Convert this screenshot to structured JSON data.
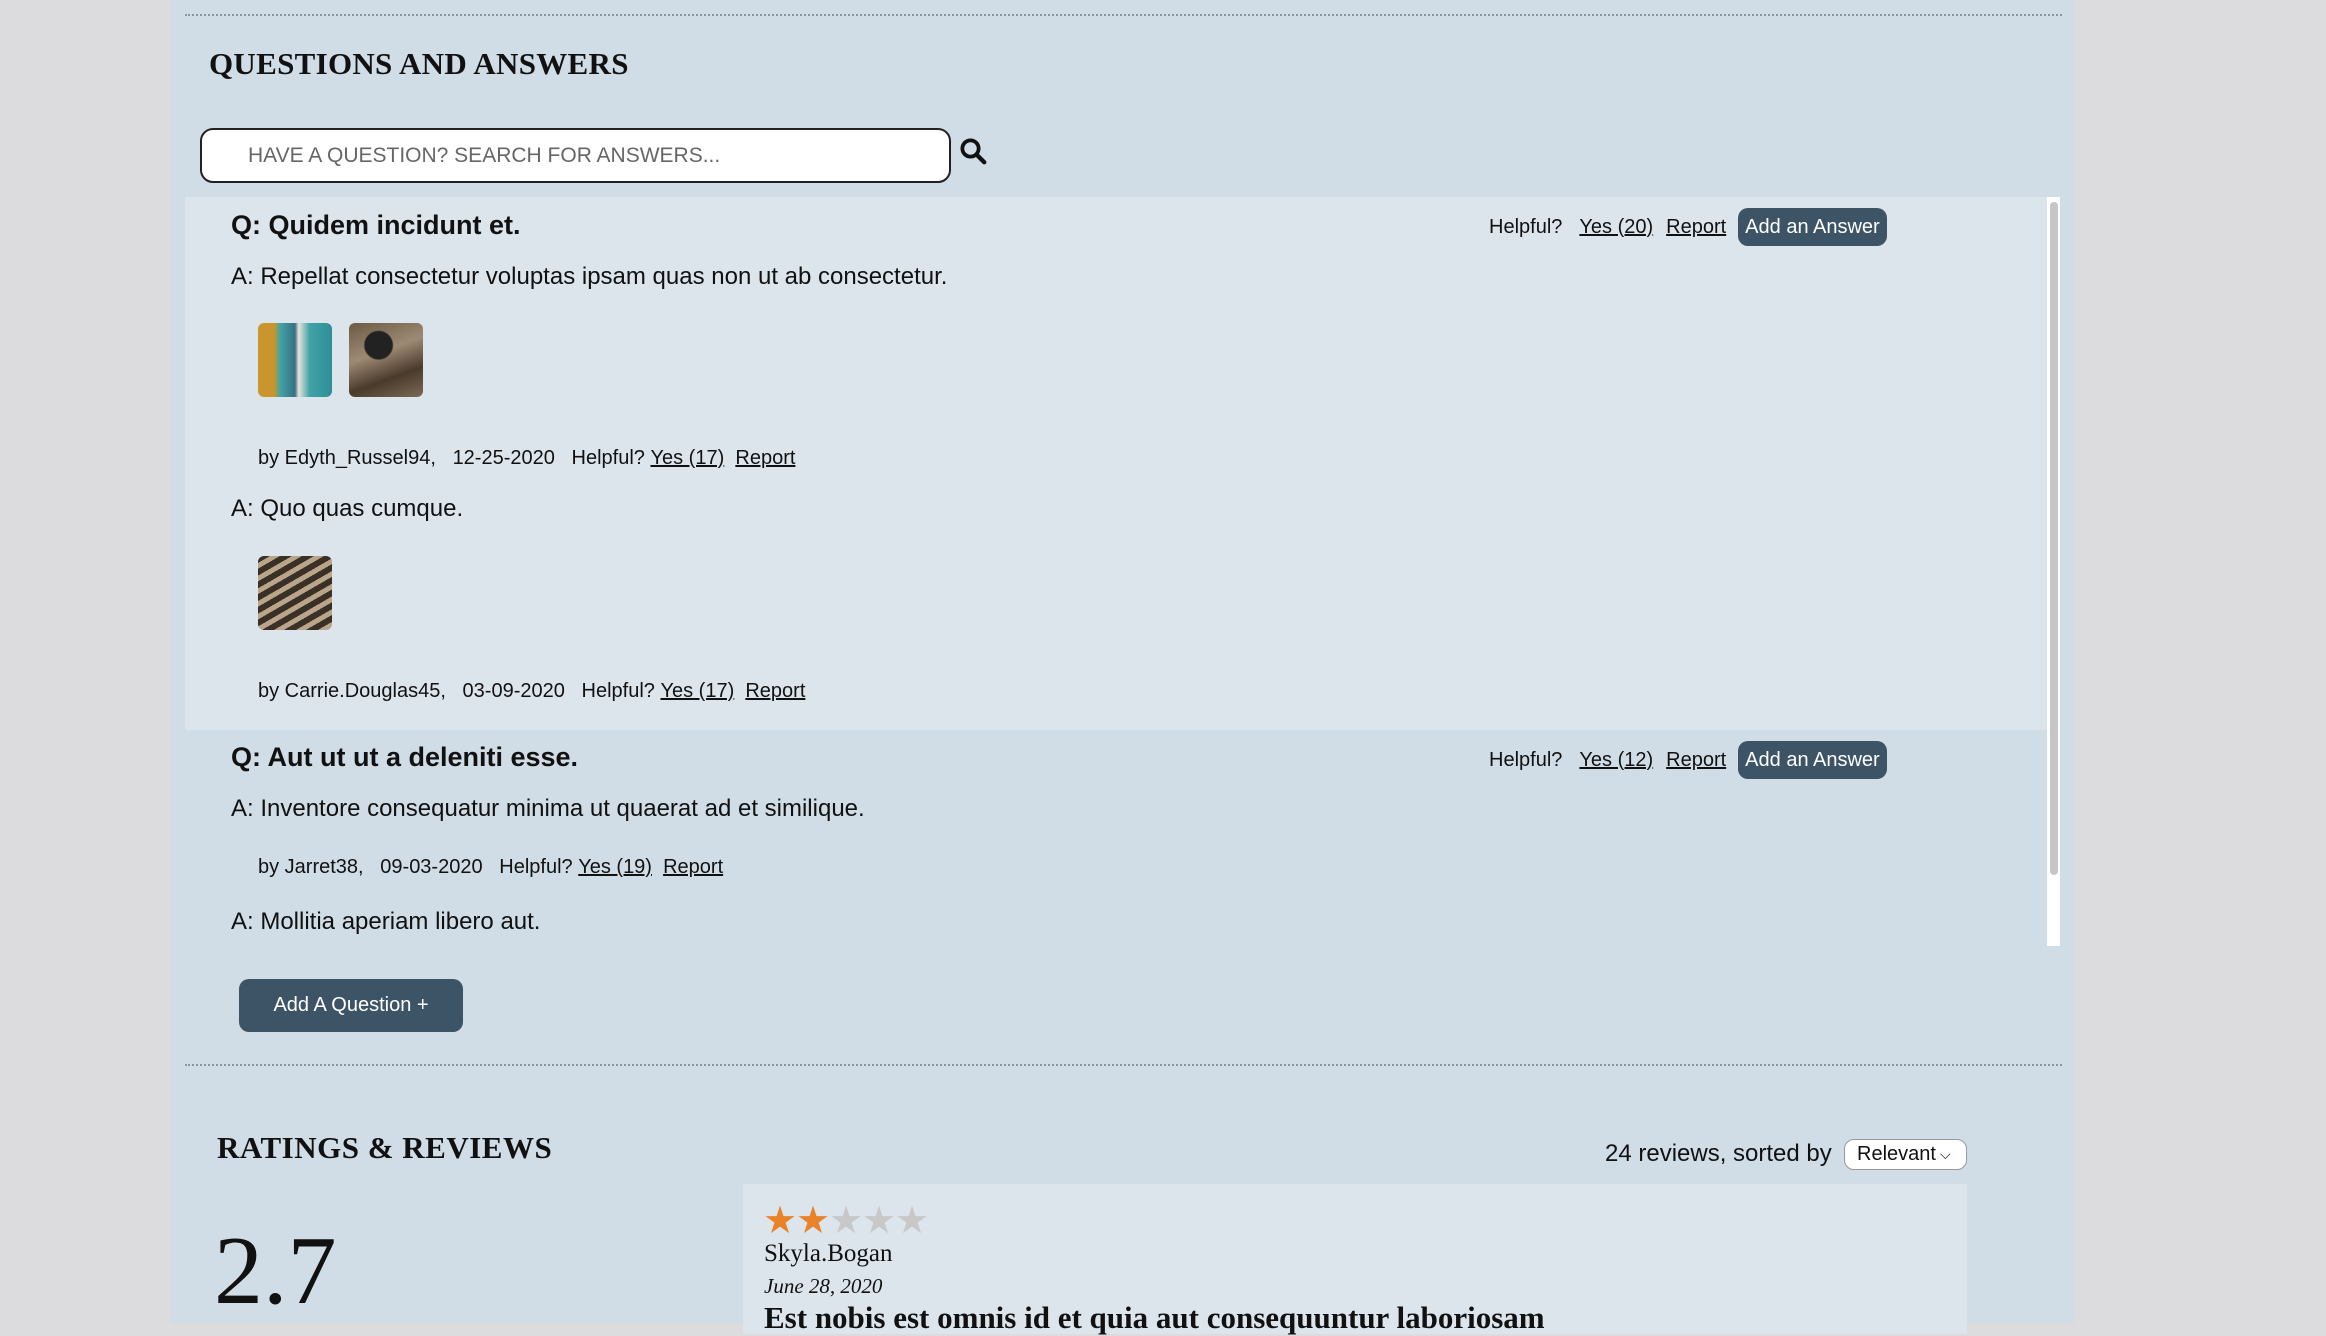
{
  "qa": {
    "title": "QUESTIONS AND ANSWERS",
    "search_placeholder": "HAVE A QUESTION? SEARCH FOR ANSWERS...",
    "questions": [
      {
        "question": "Q: Quidem incidunt et.",
        "helpful_label": "Helpful?",
        "yes": "Yes (20)",
        "report": "Report",
        "add_answer": "Add an Answer",
        "answers": [
          {
            "text": "A: Repellat consectetur voluptas ipsam quas non ut ab consectetur.",
            "by": "by Edyth_Russel94,",
            "date": "12-25-2020",
            "helpful_label": "Helpful?",
            "yes": "Yes (17)",
            "report": "Report"
          },
          {
            "text": "A: Quo quas cumque.",
            "by": "by Carrie.Douglas45,",
            "date": "03-09-2020",
            "helpful_label": "Helpful?",
            "yes": "Yes (17)",
            "report": "Report"
          }
        ]
      },
      {
        "question": "Q: Aut ut ut a deleniti esse.",
        "helpful_label": "Helpful?",
        "yes": "Yes (12)",
        "report": "Report",
        "add_answer": "Add an Answer",
        "answers": [
          {
            "text": "A: Inventore consequatur minima ut quaerat ad et similique.",
            "by": "by Jarret38,",
            "date": "09-03-2020",
            "helpful_label": "Helpful?",
            "yes": "Yes (19)",
            "report": "Report"
          },
          {
            "text": "A: Mollitia aperiam libero aut."
          }
        ]
      }
    ],
    "add_question": "Add A Question +"
  },
  "reviews": {
    "title": "RATINGS & REVIEWS",
    "count_text": "24 reviews, sorted by",
    "sort_selected": "Relevant",
    "average": "2.7",
    "items": [
      {
        "rating": 2,
        "max": 5,
        "reviewer": "Skyla.Bogan",
        "date": "June 28, 2020",
        "summary": "Est nobis est omnis id et quia aut consequuntur laboriosam"
      }
    ]
  },
  "colors": {
    "accent": "#3d5466",
    "star_filled": "#e8832a",
    "star_empty": "#c8c8c8",
    "panel": "#d0dde6",
    "card": "#dde5ec"
  }
}
